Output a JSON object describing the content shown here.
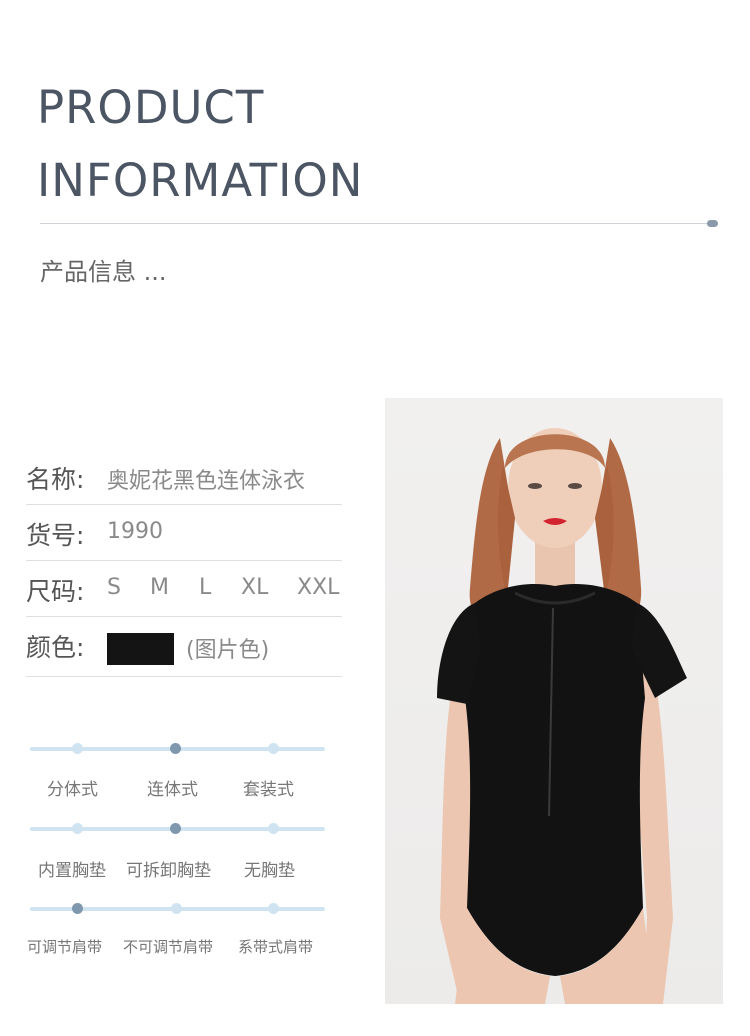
{
  "header": {
    "title_line1": "PRODUCT",
    "title_line2": "INFORMATION",
    "subtitle": "产品信息 ..."
  },
  "info": {
    "name_label": "名称:",
    "name_value": "奥妮花黑色连体泳衣",
    "sku_label": "货号:",
    "sku_value": "1990",
    "size_label": "尺码:",
    "sizes": [
      "S",
      "M",
      "L",
      "XL",
      "XXL"
    ],
    "color_label": "颜色:",
    "color_note": "(图片色)",
    "swatch_color": "#141414"
  },
  "options": {
    "style": {
      "labels": [
        "分体式",
        "连体式",
        "套装式"
      ],
      "selected": 1
    },
    "padding": {
      "labels": [
        "内置胸垫",
        "可拆卸胸垫",
        "无胸垫"
      ],
      "selected": 1
    },
    "strap": {
      "labels": [
        "可调节肩带",
        "不可调节肩带",
        "系带式肩带"
      ],
      "selected": 0
    }
  },
  "colors": {
    "track": "#cfe3f1",
    "active_dot": "#7f98ae",
    "title": "#4b5563"
  },
  "photo": {
    "subject": "model wearing black short-sleeve zip one-piece swimsuit"
  }
}
